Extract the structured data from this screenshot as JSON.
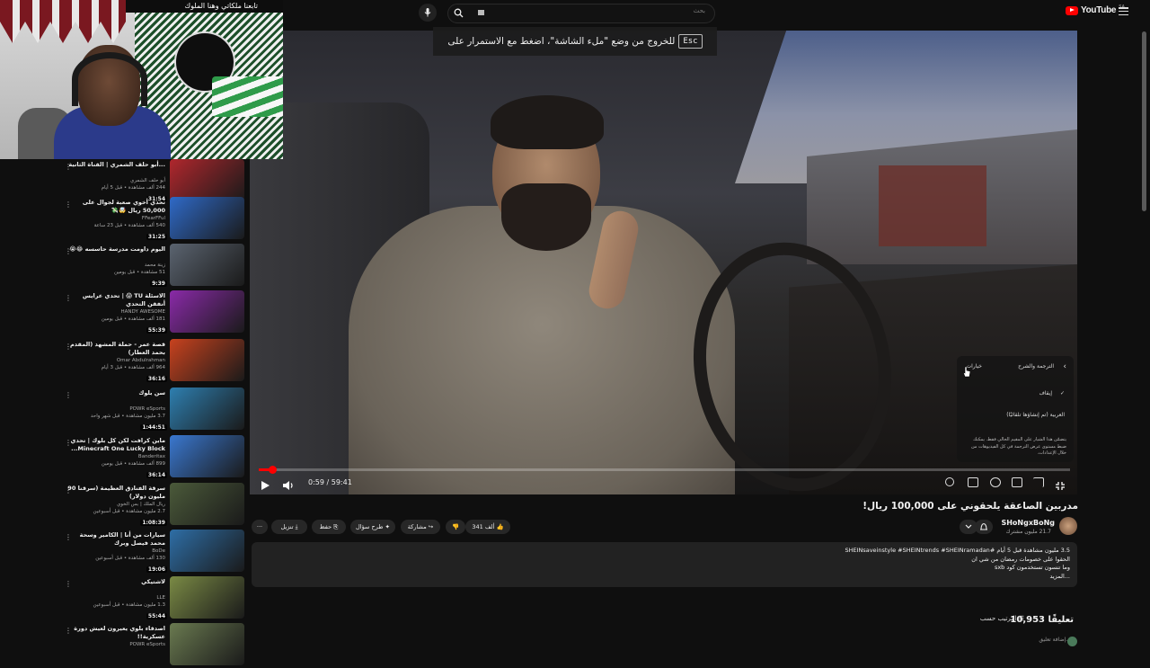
{
  "header": {
    "search_placeholder": "بحث",
    "logo_text": "YouTube",
    "logo_country": "SA"
  },
  "fullscreen_hint": {
    "text": "للخروج من وضع \"ملء الشاشة\"، اضغط مع الاستمرار على",
    "key": "Esc"
  },
  "webcam": {
    "banner_text": "تابعنا ملكاتي وهنا الملوك"
  },
  "player": {
    "time": "0:59 / 59:41",
    "progress": 0.017,
    "settings_menu": {
      "header_back": "‹",
      "header_title": "الترجمة والشرح",
      "header_option": "خيارات",
      "off_label": "إيقاف",
      "auto_label": "العربية (تم إنشاؤها تلقائيًا)",
      "note": "يتضمّن هذا الشيار على المقيم الحالي فقط. يمكنك ضبط مستوى عرض الترجمة في كل الفيديوهات من خلال الإعدادات."
    }
  },
  "video": {
    "title": "مدربين الصاعقة يلحقوني على 100,000 ريال!",
    "channel_name": "SHoNgxBoNg",
    "channel_subs": "21.7 مليون مشترك",
    "like_count": "341 ألف",
    "share_label": "مشاركة",
    "ask_label": "طرح سؤال",
    "save_label": "حفظ",
    "download_label": "تنزيل",
    "more_label": "···",
    "description_stats": "3.5 مليون مشاهدة  قبل 5 أيام  #SHEINsaveinstyle #SHEINtrends #SHEINramadan",
    "description_line1": "الحقوا على خصومات رمضان من شي ان",
    "description_line2": "وما تنسون تستخدمون كود sxb",
    "description_more": "...المزيد"
  },
  "comments": {
    "count": "10,953 تعليقًا",
    "sort_label": "الترتيب حسب",
    "add_placeholder": "إضافة تعليق..."
  },
  "sidebar": {
    "items": [
      {
        "title": "...أبو حلف الشمري | القناة الثانية",
        "channel": "أبو حلف الشمري",
        "meta": "244 ألف مشاهدة • قبل 5 أيام",
        "duration": "31:54",
        "color": "#b0272d"
      },
      {
        "title": "تحدي أخوي صعبة لجوال على 50,000 ريال 🤯💸",
        "channel": "FFearFFul",
        "meta": "540 ألف مشاهدة • قبل 23 ساعة",
        "duration": "31:25",
        "color": "#2f6ac8"
      },
      {
        "title": "اليوم داومت مدرسة حاسسه 😂😭",
        "channel": "زينة محمد",
        "meta": "51 مشاهدة • قبل يومين",
        "duration": "9:39",
        "color": "#5b6470"
      },
      {
        "title": "الاسئلة TU 😱 | تحدي عرايس أنفقن التحدي",
        "channel": "HANDY AWESOME",
        "meta": "181 ألف مشاهدة • قبل يومين",
        "duration": "55:39",
        "color": "#8a2aa8"
      },
      {
        "title": "قصة عمر - حملة المشهد (المقدم بحمد العطار)",
        "channel": "Omar Abdulrahman",
        "meta": "964 ألف مشاهدة • قبل 3 أيام",
        "duration": "36:16",
        "color": "#c8421e"
      },
      {
        "title": "سن بلوك",
        "channel": "POWR eSports",
        "meta": "3.7 مليون مشاهدة • قبل شهر واحد",
        "duration": "1:44:51",
        "color": "#2e7fb0"
      },
      {
        "title": "ماين كرافت لكن كل بلوك | تحدي Minecraft One Lucky Block...",
        "channel": "Banderitax",
        "meta": "899 ألف مشاهدة • قبل يومين",
        "duration": "36:14",
        "color": "#3a78d0"
      },
      {
        "title": "سرقة الفنادق العظيمة (سرقنا 90 مليون دولار)",
        "channel": "ريال الملك | بس الخوي",
        "meta": "2.7 مليون مشاهدة • قبل أسبوعين",
        "duration": "1:08:39",
        "color": "#4b5a3a"
      },
      {
        "title": "سيارات من أنا | الكامير وسحة محمد فيصل وبرك",
        "channel": "BoDe",
        "meta": "130 ألف مشاهدة • قبل أسبوعين",
        "duration": "19:06",
        "color": "#2e6ea6"
      },
      {
        "title": "لاشتيكي",
        "channel": "LLE",
        "meta": "1.3 مليون مشاهدة • قبل أسبوعين",
        "duration": "55:44",
        "color": "#7a8a45"
      },
      {
        "title": "اصدقاء بلوي يعيرون لعيش دورة عسكرية!!",
        "channel": "POWR eSports",
        "meta": "",
        "duration": "",
        "color": "#6a7a50"
      }
    ]
  }
}
